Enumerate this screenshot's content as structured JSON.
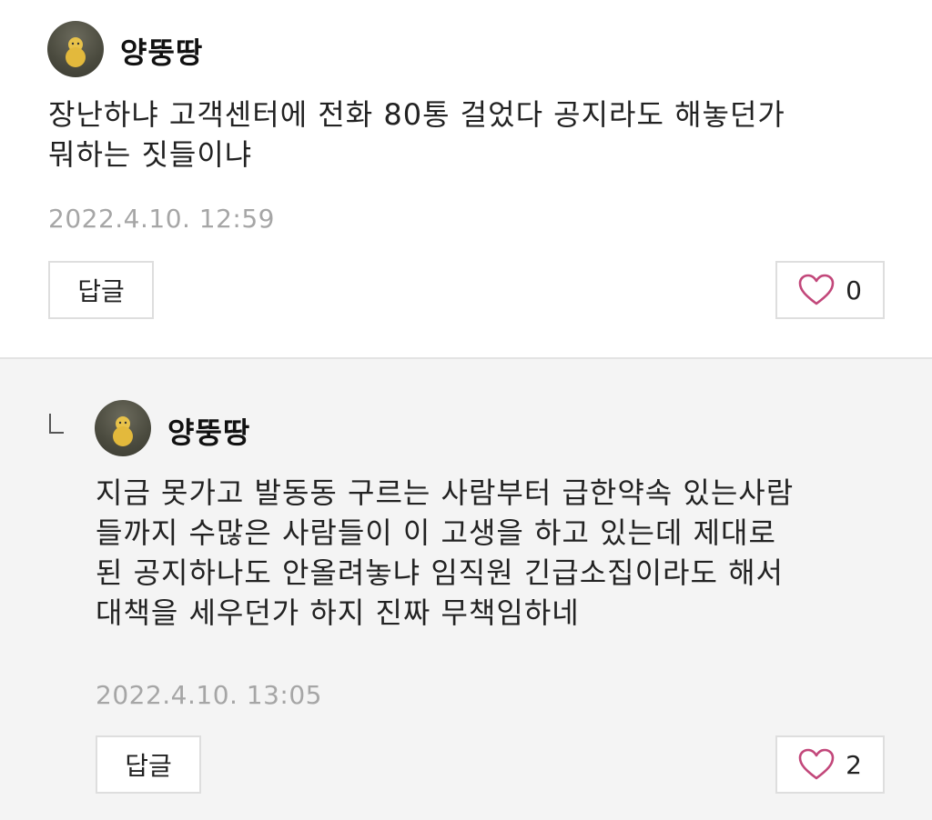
{
  "comments": [
    {
      "author": "양뚱땅",
      "avatar_icon": "chick-avatar",
      "body": "장난하냐 고객센터에 전화 80통 걸었다 공지라도 해놓던가\n뭐하는 짓들이냐",
      "timestamp": "2022.4.10. 12:59",
      "reply_label": "답글",
      "like_icon": "heart-outline-icon",
      "like_count": "0",
      "is_reply": false
    },
    {
      "author": "양뚱땅",
      "avatar_icon": "chick-avatar",
      "body": "지금 못가고 발동동 구르는 사람부터 급한약속 있는사람\n들까지 수많은 사람들이 이 고생을 하고 있는데 제대로\n된 공지하나도 안올려놓냐 임직원 긴급소집이라도 해서\n대책을 세우던가 하지 진짜 무책임하네",
      "timestamp": "2022.4.10. 13:05",
      "reply_label": "답글",
      "like_icon": "heart-outline-icon",
      "like_count": "2",
      "is_reply": true,
      "reply_marker_icon": "reply-corner-icon"
    }
  ],
  "colors": {
    "heart": "#c2477a",
    "timestamp": "#a6a6a6",
    "reply_background": "#f4f4f4",
    "border": "#dedede"
  }
}
